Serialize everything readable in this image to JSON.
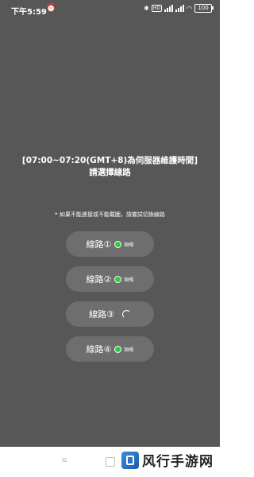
{
  "status_bar": {
    "time": "下午5:59",
    "alarm_icon": "alarm-clock-icon",
    "hd_label": "HD",
    "battery": "100"
  },
  "main": {
    "title_line1": "[07:00~07:20(GMT+8)為伺服器維護時間]",
    "title_line2": "請選擇線路",
    "notice": "* 如果不能連接或不能載圖，請嘗試切換線路",
    "routes": [
      {
        "label": "線路①",
        "status": "順暢"
      },
      {
        "label": "線路②",
        "status": "順暢"
      },
      {
        "label": "線路③",
        "status": ""
      },
      {
        "label": "線路④",
        "status": "順暢"
      }
    ]
  },
  "watermark": {
    "text": "风行手游网"
  },
  "colors": {
    "background": "#575757",
    "button": "#6e6e6e",
    "status_ok": "#2ecc40"
  }
}
